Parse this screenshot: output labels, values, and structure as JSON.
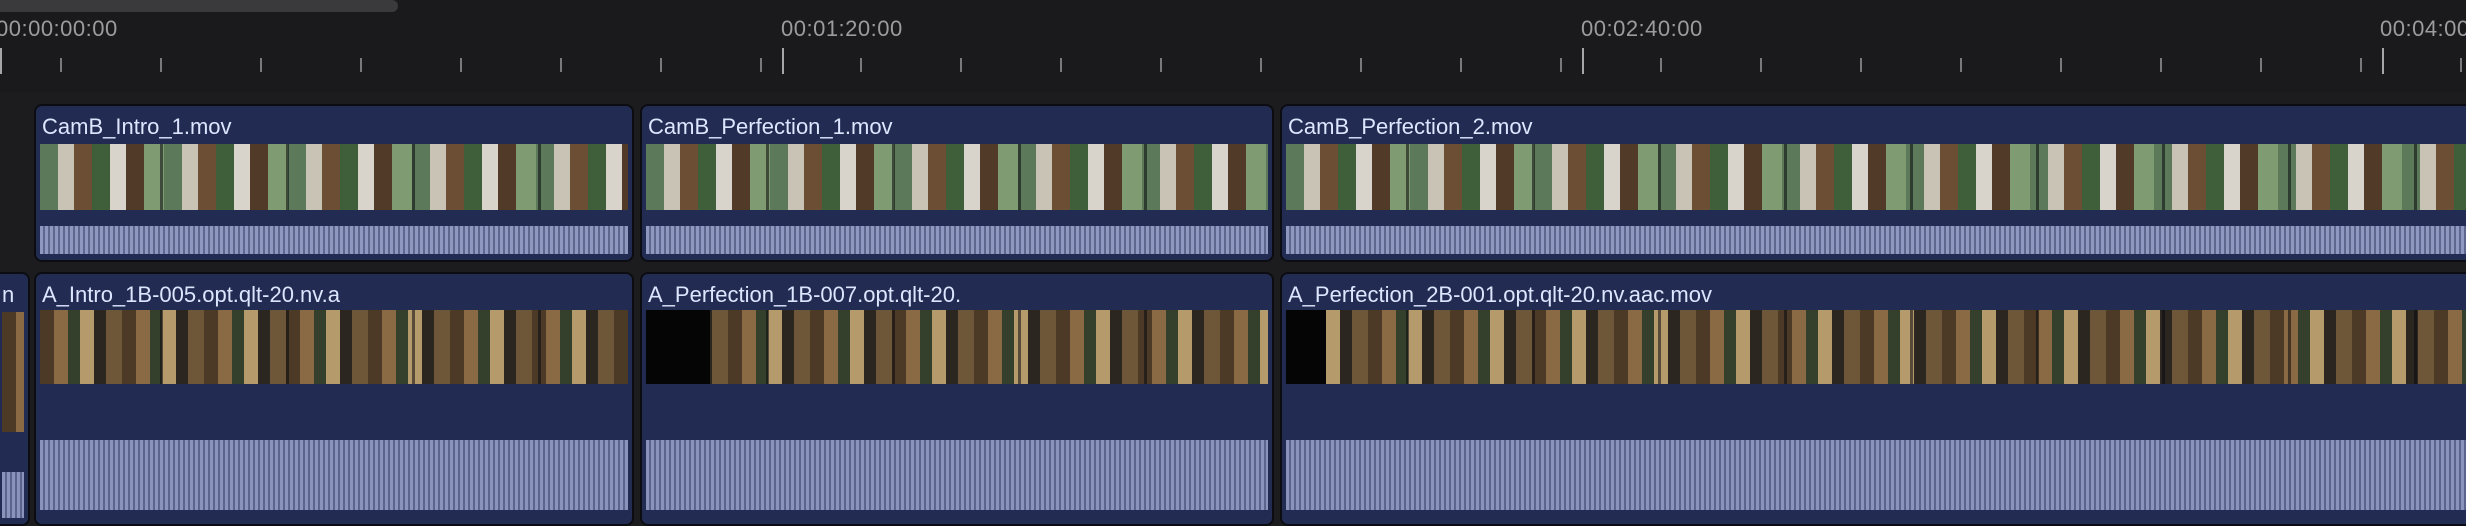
{
  "ruler": {
    "timecodes": [
      "00:00:00:00",
      "00:01:20:00",
      "00:02:40:00",
      "00:04:00"
    ]
  },
  "clips": {
    "camb_intro": {
      "title": "CamB_Intro_1.mov"
    },
    "camb_perfection_1": {
      "title": "CamB_Perfection_1.mov"
    },
    "camb_perfection_2": {
      "title": "CamB_Perfection_2.mov"
    },
    "a_partial": {
      "title": "n"
    },
    "a_intro": {
      "title": "A_Intro_1B-005.opt.qlt-20.nv.a"
    },
    "a_perfection_1b": {
      "title": "A_Perfection_1B-007.opt.qlt-20."
    },
    "a_perfection_2b": {
      "title": "A_Perfection_2B-001.opt.qlt-20.nv.aac.mov"
    }
  },
  "colors": {
    "clip_fill": "#222c52",
    "clip_title": "#dde6ff",
    "timeline_bg": "#1c1c1e",
    "waveform": "#8f98c0"
  }
}
